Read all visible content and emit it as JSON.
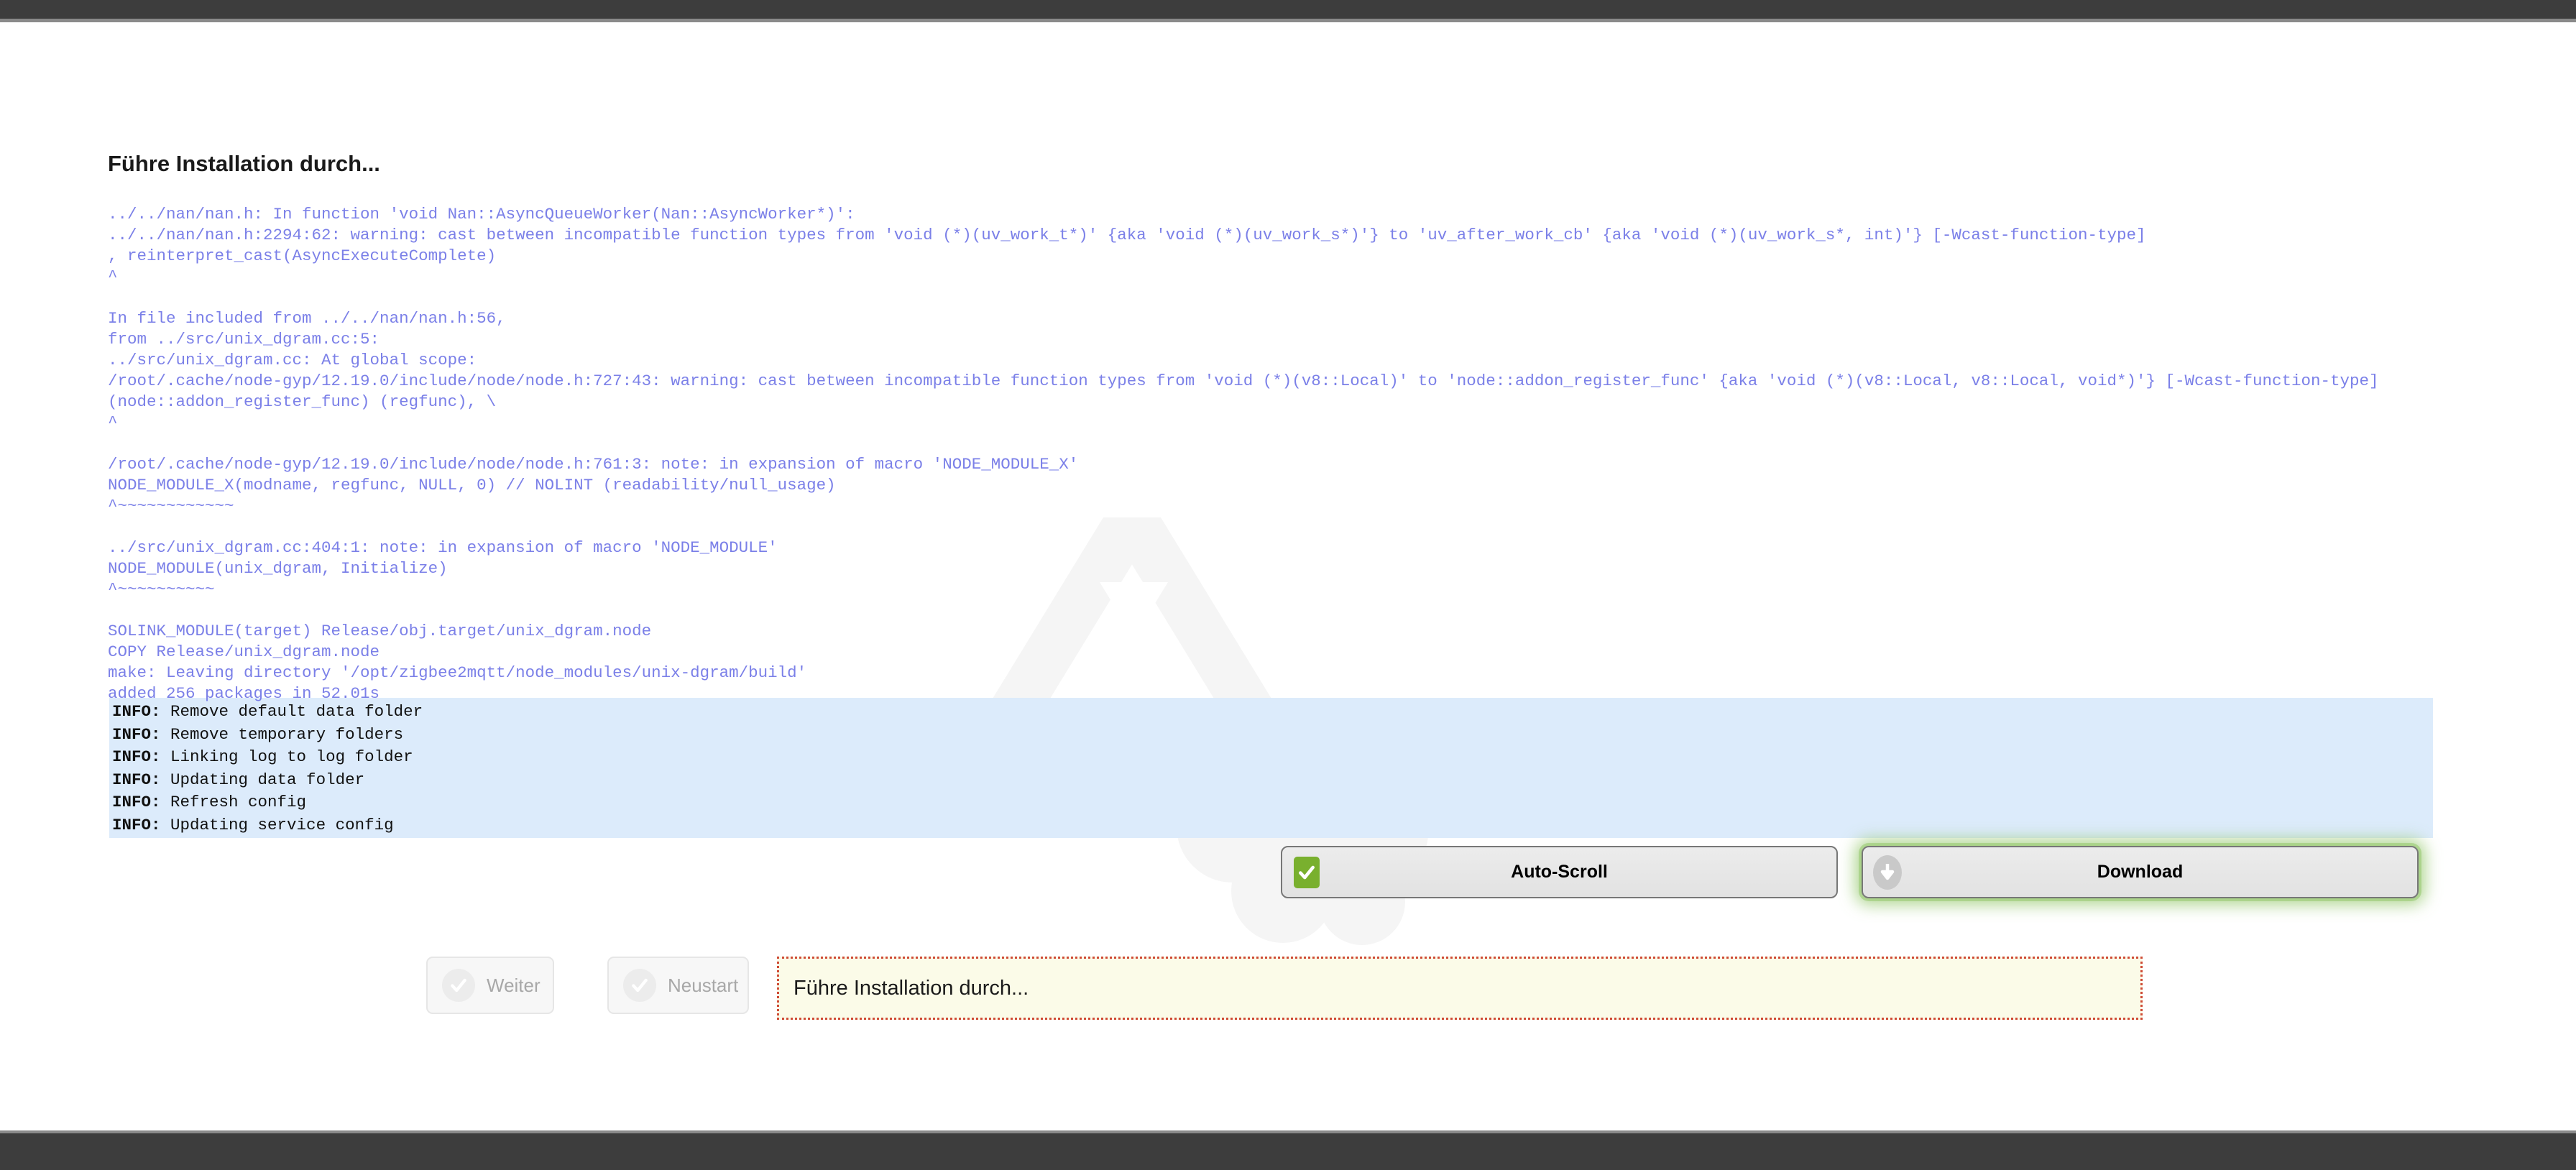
{
  "window": {
    "top_bar_color": "#3d3d3d",
    "bottom_bar_color": "#3d3d3d",
    "edge_color": "#8a8a8a"
  },
  "page": {
    "title": "Führe Installation durch..."
  },
  "log": {
    "text": "../../nan/nan.h: In function 'void Nan::AsyncQueueWorker(Nan::AsyncWorker*)':\n../../nan/nan.h:2294:62: warning: cast between incompatible function types from 'void (*)(uv_work_t*)' {aka 'void (*)(uv_work_s*)'} to 'uv_after_work_cb' {aka 'void (*)(uv_work_s*, int)'} [-Wcast-function-type]\n, reinterpret_cast(AsyncExecuteComplete)\n^\n\nIn file included from ../../nan/nan.h:56,\nfrom ../src/unix_dgram.cc:5:\n../src/unix_dgram.cc: At global scope:\n/root/.cache/node-gyp/12.19.0/include/node/node.h:727:43: warning: cast between incompatible function types from 'void (*)(v8::Local)' to 'node::addon_register_func' {aka 'void (*)(v8::Local, v8::Local, void*)'} [-Wcast-function-type]\n(node::addon_register_func) (regfunc), \\\n^\n\n/root/.cache/node-gyp/12.19.0/include/node/node.h:761:3: note: in expansion of macro 'NODE_MODULE_X'\nNODE_MODULE_X(modname, regfunc, NULL, 0) // NOLINT (readability/null_usage)\n^~~~~~~~~~~~~\n\n../src/unix_dgram.cc:404:1: note: in expansion of macro 'NODE_MODULE'\nNODE_MODULE(unix_dgram, Initialize)\n^~~~~~~~~~~\n\nSOLINK_MODULE(target) Release/obj.target/unix_dgram.node\nCOPY Release/unix_dgram.node\nmake: Leaving directory '/opt/zigbee2mqtt/node_modules/unix-dgram/build'\nadded 256 packages in 52.01s",
    "text_color": "#7b80e8",
    "info_block": {
      "background_color": "#dcebfb",
      "level": "INFO:",
      "lines": [
        "Remove default data folder",
        "Remove temporary folders",
        "Linking log to log folder",
        "Updating data folder",
        "Refresh config",
        "Updating service config"
      ]
    }
  },
  "toolbar": {
    "autoscroll_label": "Auto-Scroll",
    "autoscroll_checked": true,
    "autoscroll_accent": "#79b02e",
    "download_label": "Download",
    "download_focus_glow": "#96c86e"
  },
  "footer": {
    "weiter_label": "Weiter",
    "neustart_label": "Neustart",
    "status_message": "Führe Installation durch...",
    "status_border_color": "#cf4b36",
    "status_background_color": "#fbfbe8"
  }
}
